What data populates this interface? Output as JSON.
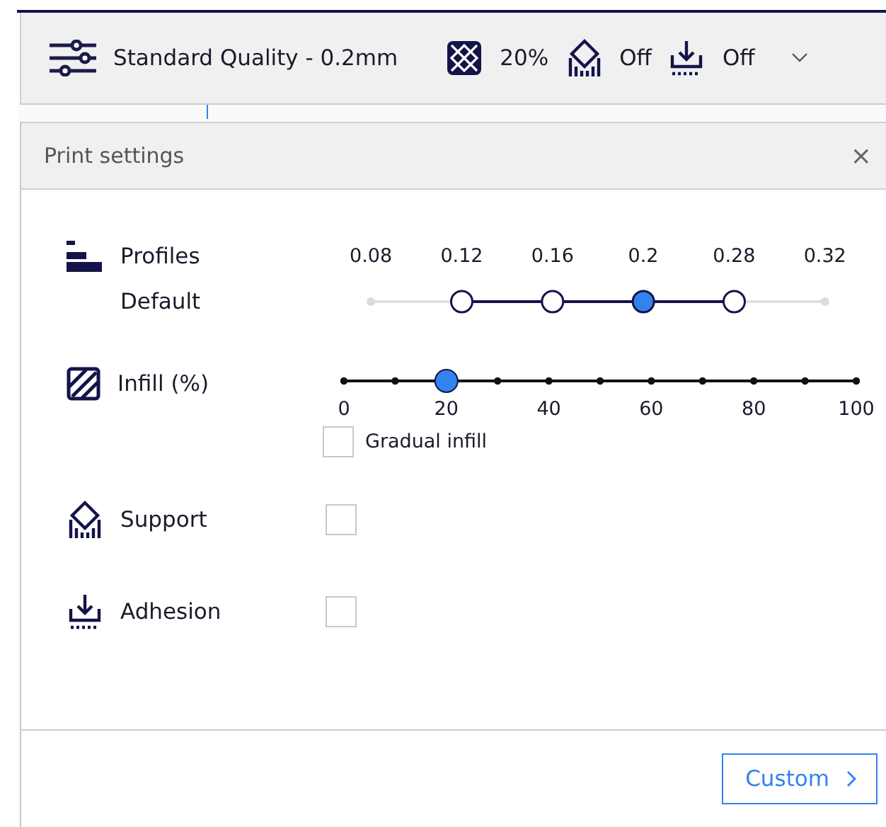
{
  "toolbar": {
    "profile": "Standard Quality - 0.2mm",
    "infill": "20%",
    "support": "Off",
    "adhesion": "Off"
  },
  "panel": {
    "title": "Print settings",
    "close": "×",
    "profiles": {
      "label": "Profiles",
      "sublabel": "Default",
      "options": [
        {
          "label": "0.08",
          "available": false,
          "selected": false
        },
        {
          "label": "0.12",
          "available": true,
          "selected": false
        },
        {
          "label": "0.16",
          "available": true,
          "selected": false
        },
        {
          "label": "0.2",
          "available": true,
          "selected": true
        },
        {
          "label": "0.28",
          "available": true,
          "selected": false
        },
        {
          "label": "0.32",
          "available": false,
          "selected": false
        }
      ]
    },
    "infill": {
      "label": "Infill (%)",
      "level": 0.2,
      "ticks": [
        "0",
        "20",
        "40",
        "60",
        "80",
        "100"
      ],
      "gradual": {
        "label": "Gradual infill",
        "checked": false
      }
    },
    "support": {
      "label": "Support",
      "checked": false
    },
    "adhesion": {
      "label": "Adhesion",
      "checked": false
    },
    "button": "Custom"
  }
}
